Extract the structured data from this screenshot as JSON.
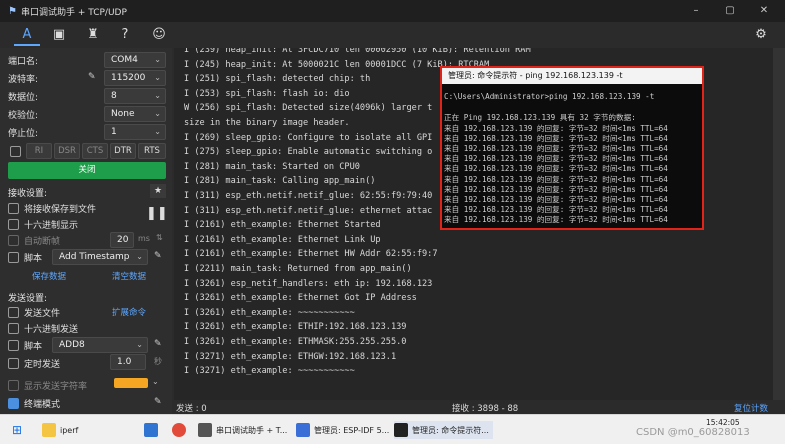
{
  "window": {
    "title": "串口调试助手 + TCP/UDP",
    "minimize": "–",
    "maximize": "▢",
    "close": "✕"
  },
  "toolbar": {
    "icons": [
      "font-icon",
      "image-icon",
      "shirt-icon",
      "help-icon",
      "smiley-icon",
      "settings-icon"
    ]
  },
  "left": {
    "port": {
      "label": "端口名:",
      "value": "COM4"
    },
    "baud": {
      "label": "波特率:",
      "value": "115200"
    },
    "databits": {
      "label": "数据位:",
      "value": "8"
    },
    "parity": {
      "label": "校验位:",
      "value": "None"
    },
    "stopbits": {
      "label": "停止位:",
      "value": "1"
    },
    "flow": [
      "RI",
      "DSR",
      "CTS",
      "DTR",
      "RTS"
    ],
    "close_button": "关闭",
    "receive_settings": "接收设置:",
    "save_to_file": "将接收保存到文件",
    "hex_display": "十六进制显示",
    "auto_break": "自动断帧",
    "auto_break_value": "20",
    "auto_break_unit": "ms",
    "script_label": "脚本",
    "script_value": "Add Timestamp",
    "save_data": "保存数据",
    "clear_data": "清空数据",
    "send_settings": "发送设置:",
    "send_file": "发送文件",
    "expand_cmd": "扩展命令",
    "hex_send": "十六进制发送",
    "script2_label": "脚本",
    "script2_value": "ADD8",
    "timed_send": "定时发送",
    "timed_value": "1.0",
    "timed_unit": "秒",
    "show_rate": "显示发送字符率",
    "terminal_mode": "终端模式"
  },
  "terminal": {
    "lines": [
      "I (239) heap_init: At 3FCDC710 len 00002950 (10 KiB): Retention RAM",
      "I (245) heap_init: At 5000021C len 00001DCC (7 KiB): RTCRAM",
      "I (251) spi_flash: detected chip: th",
      "I (253) spi_flash: flash io: dio",
      "W (256) spi_flash: Detected size(4096k) larger t",
      "size in the binary image header.",
      "I (269) sleep_gpio: Configure to isolate all GPI",
      "I (275) sleep_gpio: Enable automatic switching o",
      "I (281) main_task: Started on CPU0",
      "I (281) main_task: Calling app_main()",
      "I (311) esp_eth.netif.netif_glue: 62:55:f9:79:40",
      "I (311) esp_eth.netif.netif_glue: ethernet attac",
      "I (2161) eth_example: Ethernet Started",
      "I (2161) eth_example: Ethernet Link Up",
      "I (2161) eth_example: Ethernet HW Addr 62:55:f9:7",
      "I (2211) main_task: Returned from app_main()",
      "I (3261) esp_netif_handlers: eth ip: 192.168.123",
      "I (3261) eth_example: Ethernet Got IP Address",
      "I (3261) eth_example: ~~~~~~~~~~~",
      "I (3261) eth_example: ETHIP:192.168.123.139",
      "I (3261) eth_example: ETHMASK:255.255.255.0",
      "I (3271) eth_example: ETHGW:192.168.123.1",
      "I (3271) eth_example: ~~~~~~~~~~~"
    ]
  },
  "cmd": {
    "title": "管理员: 命令提示符 - ping  192.168.123.139 -t",
    "lines": [
      "C:\\Users\\Administrator>ping 192.168.123.139 -t",
      "",
      "正在 Ping 192.168.123.139 具有 32 字节的数据:",
      "来自 192.168.123.139 的回复: 字节=32 时间<1ms TTL=64",
      "来自 192.168.123.139 的回复: 字节=32 时间<1ms TTL=64",
      "来自 192.168.123.139 的回复: 字节=32 时间<1ms TTL=64",
      "来自 192.168.123.139 的回复: 字节=32 时间<1ms TTL=64",
      "来自 192.168.123.139 的回复: 字节=32 时间<1ms TTL=64",
      "来自 192.168.123.139 的回复: 字节=32 时间<1ms TTL=64",
      "来自 192.168.123.139 的回复: 字节=32 时间<1ms TTL=64",
      "来自 192.168.123.139 的回复: 字节=32 时间<1ms TTL=64",
      "来自 192.168.123.139 的回复: 字节=32 时间<1ms TTL=64",
      "来自 192.168.123.139 的回复: 字节=32 时间<1ms TTL=64"
    ]
  },
  "status": {
    "send": "发送 : 0",
    "recv": "接收 : 3898 - 88",
    "reset": "复位计数"
  },
  "taskbar": {
    "iperf": "iperf",
    "app1": "串口调试助手 + T...",
    "app2": "管理员: ESP-IDF 5...",
    "app3": "管理员: 命令提示符...",
    "time": "15:42:05",
    "watermark": "CSDN @m0_60828013"
  },
  "colors": {
    "accent": "#1e9e4a",
    "link": "#5da7ff",
    "highlight": "#e2231a",
    "checkbox_on": "#4a8fe0"
  }
}
